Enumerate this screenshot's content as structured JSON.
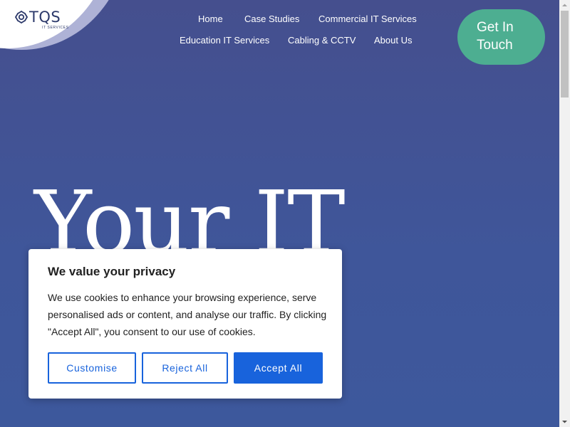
{
  "brand": {
    "name": "TQS",
    "tagline": "IT SERVICES"
  },
  "nav": {
    "items": [
      {
        "label": "Home"
      },
      {
        "label": "Case Studies"
      },
      {
        "label": "Commercial IT Services"
      },
      {
        "label": "Education IT Services"
      },
      {
        "label": "Cabling & CCTV"
      },
      {
        "label": "About Us"
      }
    ],
    "cta_line1": "Get In",
    "cta_line2": "Touch"
  },
  "hero": {
    "heading": "Your IT"
  },
  "cookie": {
    "title": "We value your privacy",
    "text": "We use cookies to enhance your browsing experience, serve personalised ads or content, and analyse our traffic. By clicking \"Accept All\", you consent to our use of cookies.",
    "customise_label": "Customise",
    "reject_label": "Reject All",
    "accept_label": "Accept All"
  },
  "colors": {
    "hero_background": "#4353960",
    "cta_green": "#4dae91",
    "accent_blue": "#1863dc",
    "logo_navy": "#2d3a6b"
  },
  "icons": {
    "logo_mark": "tqs-logo-icon",
    "scroll_up": "scroll-up-arrow-icon",
    "scroll_down": "scroll-down-arrow-icon"
  }
}
